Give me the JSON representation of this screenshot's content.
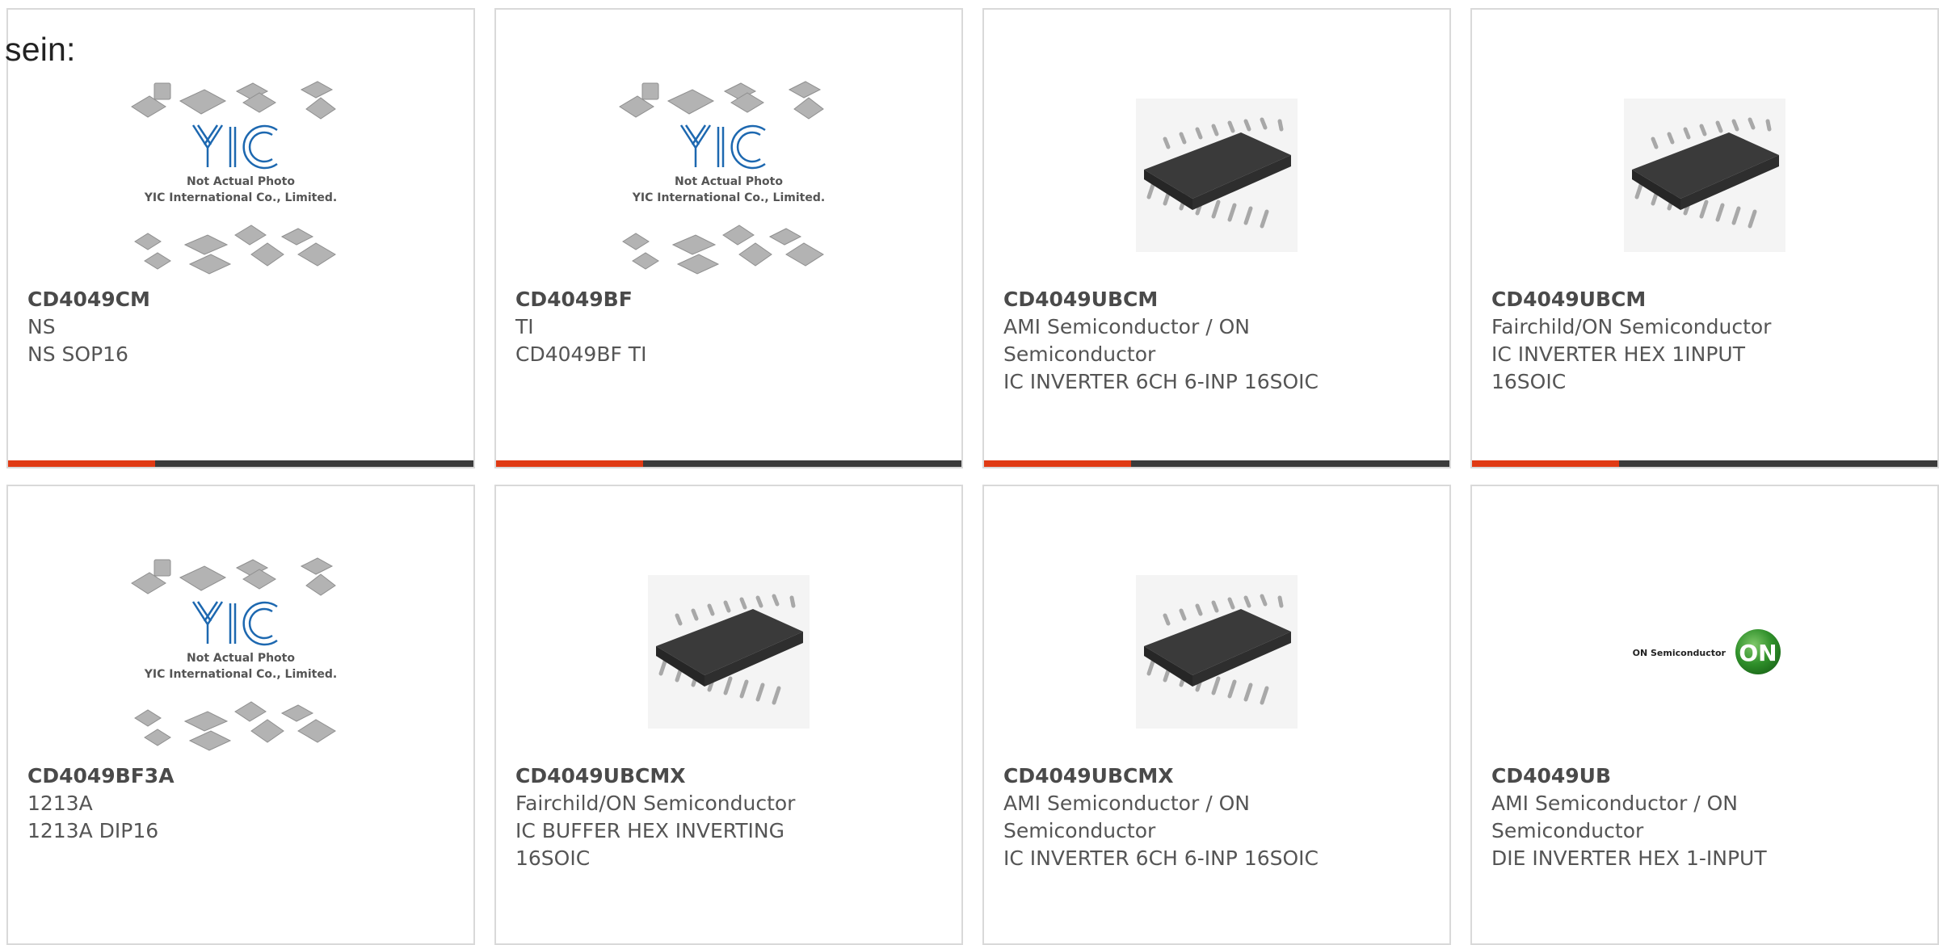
{
  "intro_text": "sein:",
  "watermark": {
    "logo": "YIC",
    "line1": "Not Actual Photo",
    "line2": "YIC International Co., Limited."
  },
  "brand_logo": {
    "text": "ON Semiconductor",
    "badge": "ON"
  },
  "colors": {
    "accent": "#e03a14",
    "bar": "#3b3b3b",
    "border": "#d9d9d9"
  },
  "products": [
    {
      "part": "CD4049CM",
      "manufacturer": "NS",
      "description": "NS SOP16",
      "image": "placeholder"
    },
    {
      "part": "CD4049BF",
      "manufacturer": "TI",
      "description": "CD4049BF TI",
      "image": "placeholder"
    },
    {
      "part": "CD4049UBCM",
      "manufacturer": "AMI Semiconductor / ON Semiconductor",
      "description": "IC INVERTER 6CH 6-INP 16SOIC",
      "image": "chip"
    },
    {
      "part": "CD4049UBCM",
      "manufacturer": "Fairchild/ON Semiconductor",
      "description": "IC INVERTER HEX 1INPUT 16SOIC",
      "image": "chip"
    },
    {
      "part": "CD4049BF3A",
      "manufacturer": "1213A",
      "description": "1213A DIP16",
      "image": "placeholder"
    },
    {
      "part": "CD4049UBCMX",
      "manufacturer": "Fairchild/ON Semiconductor",
      "description": "IC BUFFER HEX INVERTING 16SOIC",
      "image": "chip"
    },
    {
      "part": "CD4049UBCMX",
      "manufacturer": "AMI Semiconductor / ON Semiconductor",
      "description": "IC INVERTER 6CH 6-INP 16SOIC",
      "image": "chip"
    },
    {
      "part": "CD4049UB",
      "manufacturer": "AMI Semiconductor / ON Semiconductor",
      "description": "DIE INVERTER HEX 1-INPUT",
      "image": "on-logo"
    }
  ]
}
